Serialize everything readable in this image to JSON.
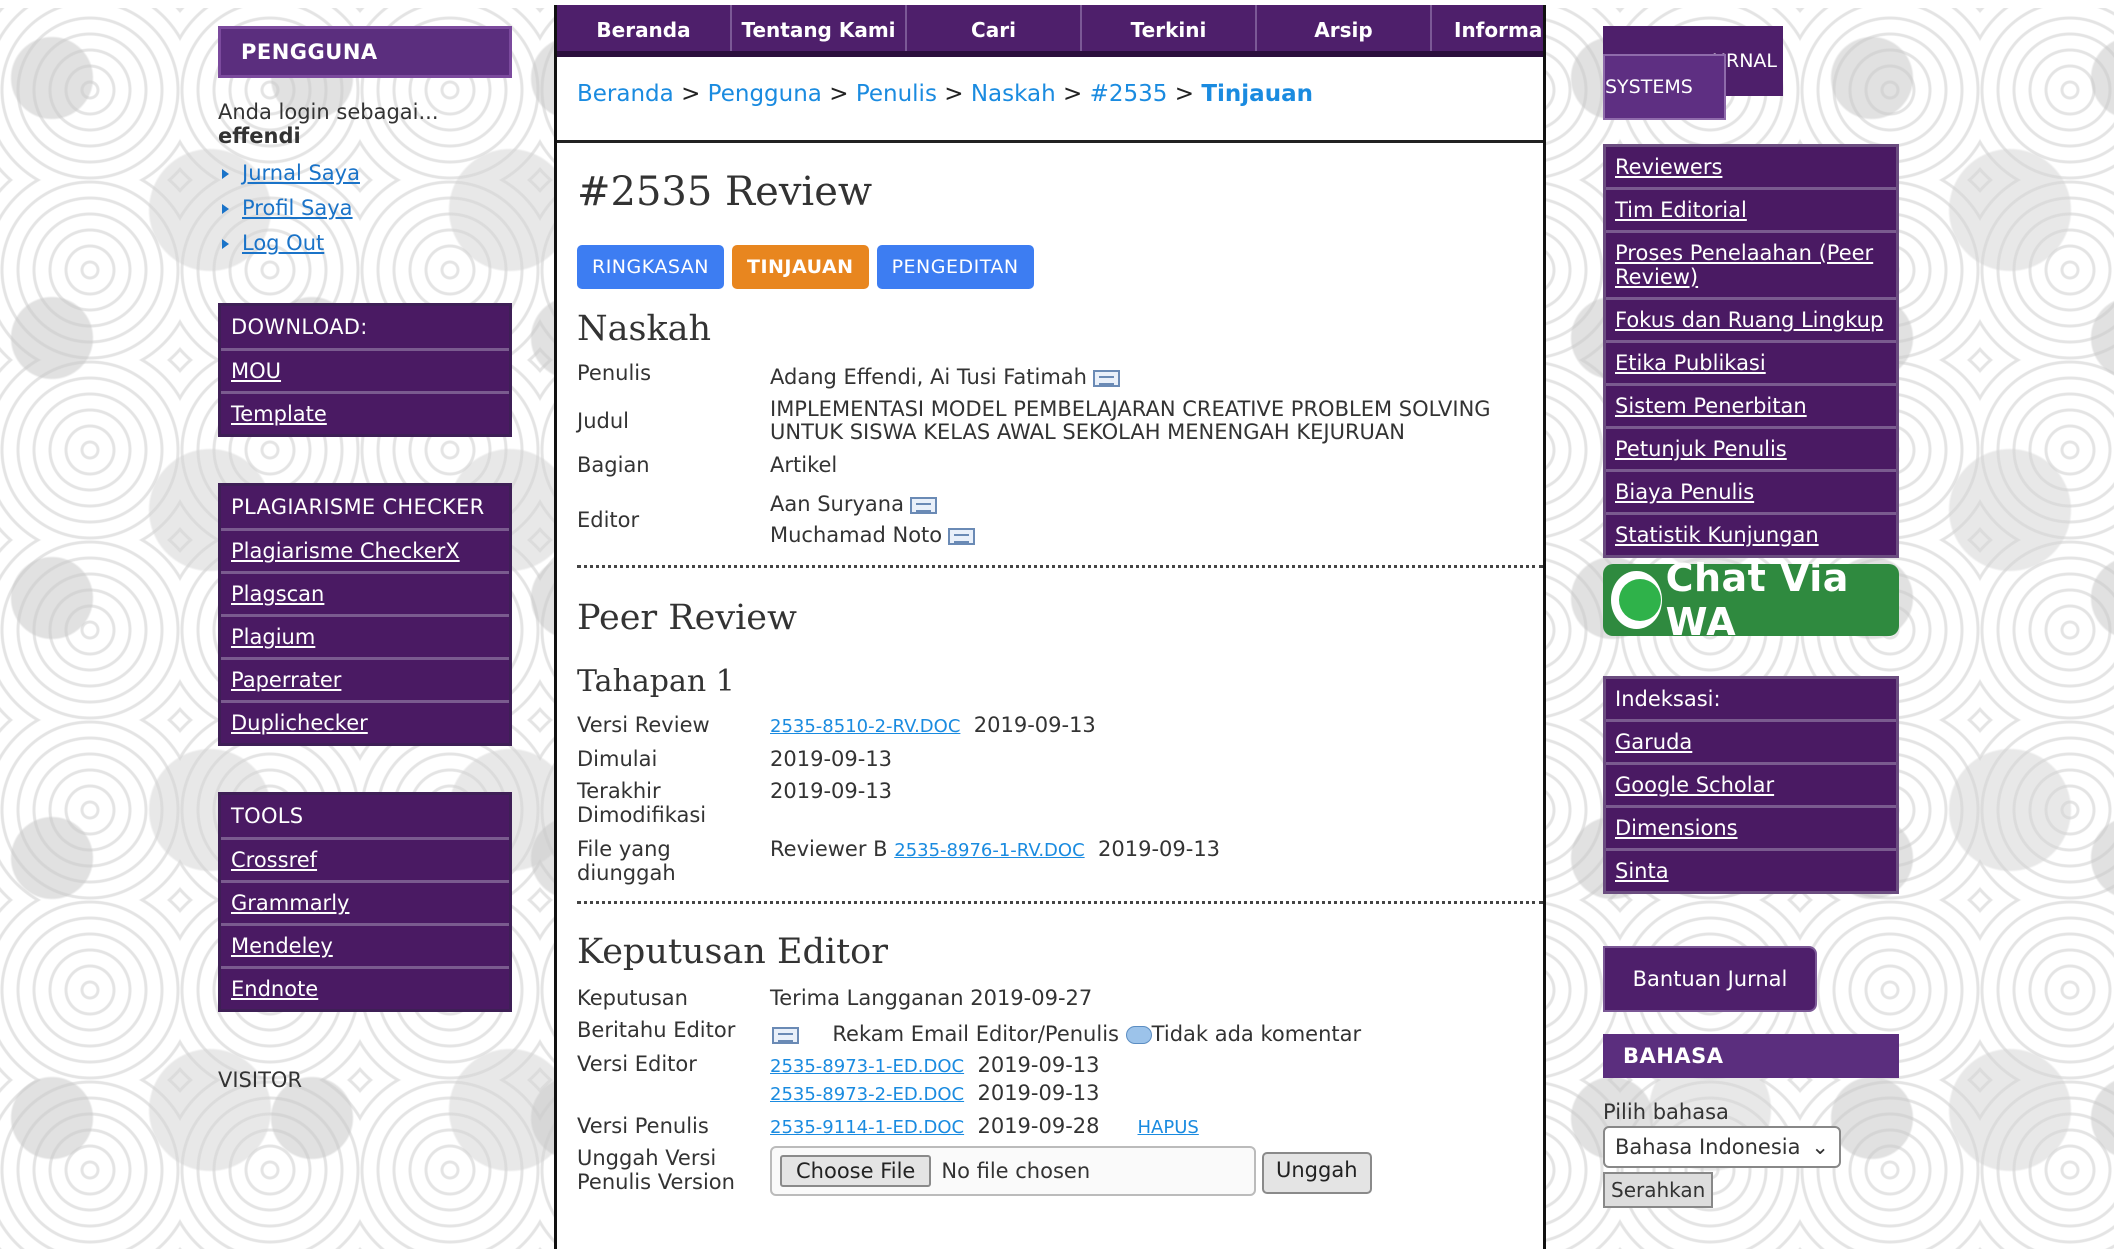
{
  "left": {
    "user_header": "PENGGUNA",
    "login_text": "Anda login sebagai...",
    "login_user": "effendi",
    "user_links": [
      "Jurnal Saya",
      "Profil Saya",
      "Log Out"
    ],
    "download": {
      "title": "DOWNLOAD:",
      "items": [
        "MOU",
        "Template"
      ]
    },
    "plagiarism": {
      "title": "PLAGIARISME CHECKER",
      "items": [
        "Plagiarisme CheckerX",
        "Plagscan",
        "Plagium",
        "Paperrater",
        "Duplichecker"
      ]
    },
    "tools": {
      "title": "TOOLS",
      "items": [
        "Crossref",
        "Grammarly",
        "Mendeley",
        "Endnote"
      ]
    },
    "visitor": "VISITOR"
  },
  "nav": [
    "Beranda",
    "Tentang Kami",
    "Cari",
    "Terkini",
    "Arsip",
    "Informa"
  ],
  "breadcrumb": {
    "items": [
      "Beranda",
      "Pengguna",
      "Penulis",
      "Naskah",
      "#2535"
    ],
    "current": "Tinjauan",
    "sep": ">"
  },
  "page_title": "#2535 Review",
  "tabs": [
    "RINGKASAN",
    "TINJAUAN",
    "PENGEDITAN"
  ],
  "naskah": {
    "title": "Naskah",
    "penulis_label": "Penulis",
    "penulis": "Adang Effendi, Ai Tusi Fatimah",
    "judul_label": "Judul",
    "judul_1": "IMPLEMENTASI MODEL PEMBELAJARAN CREATIVE PROBLEM SOLVING",
    "judul_2": "UNTUK SISWA KELAS AWAL SEKOLAH MENENGAH KEJURUAN",
    "bagian_label": "Bagian",
    "bagian": "Artikel",
    "editor_label": "Editor",
    "editor_1": "Aan Suryana",
    "editor_2": "Muchamad Noto"
  },
  "peer": {
    "title": "Peer Review",
    "stage": "Tahapan 1",
    "versi_label": "Versi Review",
    "versi_file": "2535-8510-2-RV.DOC",
    "versi_date": "2019-09-13",
    "mulai_label": "Dimulai",
    "mulai": "2019-09-13",
    "mod_label_1": "Terakhir",
    "mod_label_2": "Dimodifikasi",
    "mod": "2019-09-13",
    "file_label_1": "File yang",
    "file_label_2": "diunggah",
    "file_reviewer": "Reviewer B",
    "file_name": "2535-8976-1-RV.DOC",
    "file_date": "2019-09-13"
  },
  "keputusan": {
    "title": "Keputusan Editor",
    "kep_label": "Keputusan",
    "kep": "Terima Langganan 2019-09-27",
    "notify_label": "Beritahu Editor",
    "notify_text": "Rekam Email Editor/Penulis",
    "comment": "Tidak ada komentar",
    "ved_label": "Versi Editor",
    "ved_file_1": "2535-8973-1-ED.DOC",
    "ved_date_1": "2019-09-13",
    "ved_file_2": "2535-8973-2-ED.DOC",
    "ved_date_2": "2019-09-13",
    "vpen_label": "Versi Penulis",
    "vpen_file": "2535-9114-1-ED.DOC",
    "vpen_date": "2019-09-28",
    "hapus": "HAPUS",
    "upload_label_1": "Unggah Versi",
    "upload_label_2": "Penulis Version",
    "choose": "Choose File",
    "no_file": "No file chosen",
    "upload_btn": "Unggah"
  },
  "right": {
    "oj_back": "URNAL",
    "oj_front": "SYSTEMS",
    "links": [
      "Reviewers",
      "Tim Editorial",
      "Proses Penelaahan (Peer Review)",
      "Fokus dan Ruang Lingkup",
      "Etika Publikasi",
      "Sistem Penerbitan",
      "Petunjuk Penulis",
      "Biaya Penulis",
      "Statistik Kunjungan"
    ],
    "wa": "Chat Via WA",
    "index": {
      "title": "Indeksasi:",
      "items": [
        "Garuda",
        "Google Scholar",
        "Dimensions",
        "Sinta"
      ]
    },
    "bantuan": "Bantuan Jurnal",
    "bahasa": "BAHASA",
    "pilih": "Pilih bahasa",
    "lang": "Bahasa Indonesia",
    "serahkan": "Serahkan"
  }
}
